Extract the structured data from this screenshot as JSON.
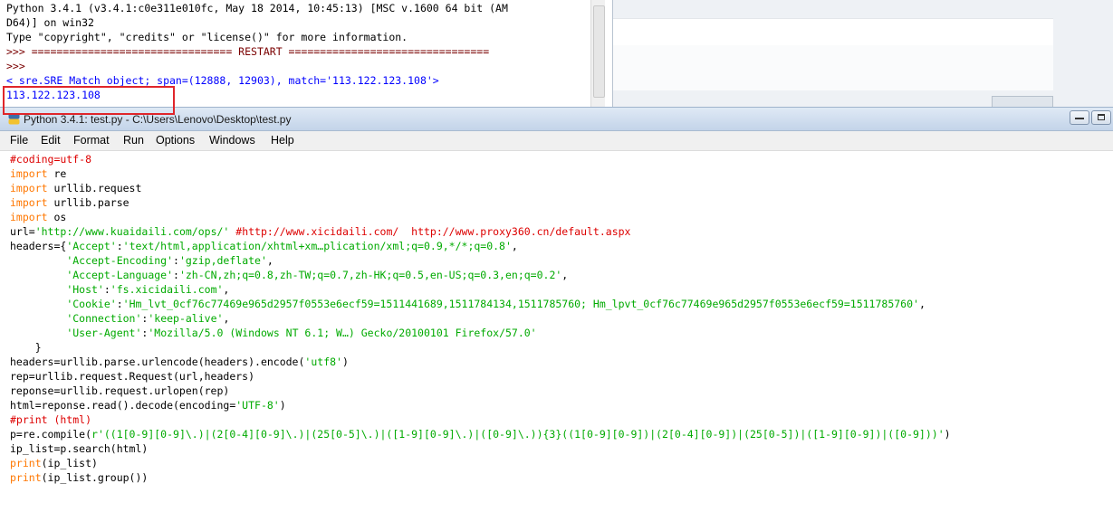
{
  "shell": {
    "lines": [
      "Python 3.4.1 (v3.4.1:c0e311e010fc, May 18 2014, 10:45:13) [MSC v.1600 64 bit (AM",
      "D64)] on win32",
      "Type \"copyright\", \"credits\" or \"license()\" for more information.",
      ">>> ================================ RESTART ================================",
      ">>>",
      "<_sre.SRE_Match object; span=(12888, 12903), match='113.122.123.108'>",
      "113.122.123.108"
    ]
  },
  "editor": {
    "title": "Python 3.4.1: test.py - C:\\Users\\Lenovo\\Desktop\\test.py",
    "menu": [
      "File",
      "Edit",
      "Format",
      "Run",
      "Options",
      "Windows",
      "Help"
    ],
    "code": [
      "#coding=utf-8",
      "import re",
      "import urllib.request",
      "import urllib.parse",
      "import os",
      "url='http://www.kuaidaili.com/ops/' #http://www.xicidaili.com/  http://www.proxy360.cn/default.aspx",
      "headers={'Accept':'text/html,application/xhtml+xm…plication/xml;q=0.9,*/*;q=0.8',",
      "         'Accept-Encoding':'gzip,deflate',",
      "         'Accept-Language':'zh-CN,zh;q=0.8,zh-TW;q=0.7,zh-HK;q=0.5,en-US;q=0.3,en;q=0.2',",
      "         'Host':'fs.xicidaili.com',",
      "         'Cookie':'Hm_lvt_0cf76c77469e965d2957f0553e6ecf59=1511441689,1511784134,1511785760; Hm_lpvt_0cf76c77469e965d2957f0553e6ecf59=1511785760',",
      "         'Connection':'keep-alive',",
      "         'User-Agent':'Mozilla/5.0 (Windows NT 6.1; W…) Gecko/20100101 Firefox/57.0'",
      "    }",
      "headers=urllib.parse.urlencode(headers).encode('utf8')",
      "rep=urllib.request.Request(url,headers)",
      "reponse=urllib.request.urlopen(rep)",
      "html=reponse.read().decode(encoding='UTF-8')",
      "#print (html)",
      "p=re.compile(r'((1[0-9][0-9]\\.)|(2[0-4][0-9]\\.)|(25[0-5]\\.)|([1-9][0-9]\\.)|([0-9]\\.)){3}((1[0-9][0-9])|(2[0-4][0-9])|(25[0-5])|([1-9][0-9])|([0-9]))')",
      "ip_list=p.search(html)",
      "print(ip_list)",
      "print(ip_list.group())"
    ]
  },
  "colors": {
    "keyword": "#ff7700",
    "string": "#00aa00",
    "comment": "#dd0000",
    "output": "#0000ff",
    "highlight_box": "#e0262b"
  },
  "icons": [
    "python-app-icon",
    "minimize-icon",
    "maximize-icon"
  ]
}
